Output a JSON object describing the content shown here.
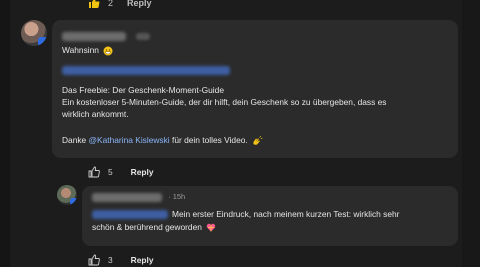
{
  "top_row": {
    "like_count": "2",
    "reply_label": "Reply"
  },
  "comment": {
    "greeting": "Wahnsinn",
    "freebie_title": "Das Freebie: Der Geschenk-Moment-Guide",
    "body_line1": "Ein kostenloser 5-Minuten-Guide, der dir hilft, dein Geschenk so zu übergeben, dass es",
    "body_line2": "wirklich ankommt.",
    "thanks_prefix": "Danke",
    "thanks_mention": "@Katharina Kislewski",
    "thanks_suffix": "für dein tolles Video.",
    "like_count": "5",
    "reply_label": "Reply"
  },
  "reply": {
    "time": "15h",
    "text_line1": "Mein erster Eindruck, nach meinem kurzen Test: wirklich sehr",
    "text_line2": "schön & berührend geworden",
    "like_count": "3",
    "reply_label": "Reply"
  },
  "icons": [
    "thumbs-up-icon",
    "verified-badge-icon",
    "grin-emoji-icon",
    "clapping-hands-emoji-icon",
    "heart-gift-emoji-icon"
  ],
  "colors": {
    "background": "#1c1c1c",
    "bubble": "#2b2b2b",
    "mention": "#8ab4f8",
    "text": "#e6e6e6"
  }
}
